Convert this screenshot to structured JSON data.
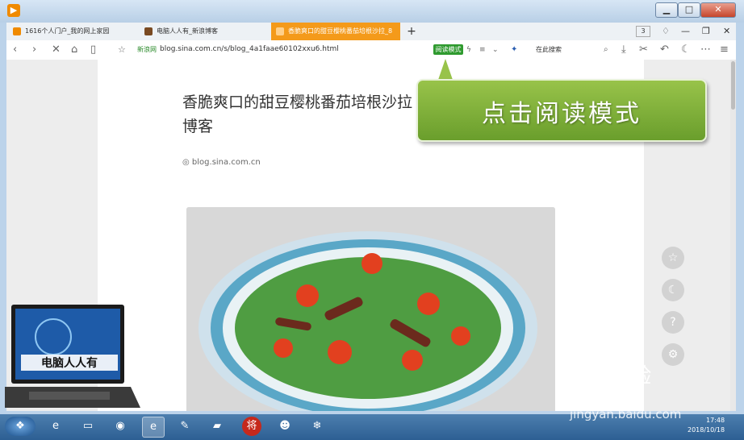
{
  "tabs": [
    {
      "label": "1616个人门户_我的网上家园"
    },
    {
      "label": "电脑人人有_新浪博客"
    },
    {
      "label": "香脆爽口的甜豆樱桃番茄培根沙拉_8"
    }
  ],
  "new_tab": "+",
  "tab_count": "3",
  "address": {
    "site_name": "新浪网",
    "url": "blog.sina.com.cn/s/blog_4a1faae60102xxu6.html",
    "reading_mode": "阅读模式",
    "search_placeholder": "在此搜索"
  },
  "article": {
    "title": "香脆爽口的甜豆樱桃番茄培根沙拉 博客",
    "title_line1": "香脆爽口的甜豆樱桃番茄培根沙拉",
    "title_line2": "博客",
    "source": "blog.sina.com.cn"
  },
  "callout": {
    "text": "点击阅读模式"
  },
  "side_buttons": [
    "star-icon",
    "moon-icon",
    "help-icon",
    "gear-icon"
  ],
  "overlay_logo": {
    "text": "电脑人人有"
  },
  "watermark": {
    "brand": "Bai 经验",
    "url": "jingyan.baidu.com"
  },
  "taskbar": {
    "time": "17:48",
    "date": "2018/10/18"
  },
  "colors": {
    "accent_tab": "#f49a1a",
    "reading_badge": "#2f9a2f",
    "callout_green": "#7fb23a"
  }
}
